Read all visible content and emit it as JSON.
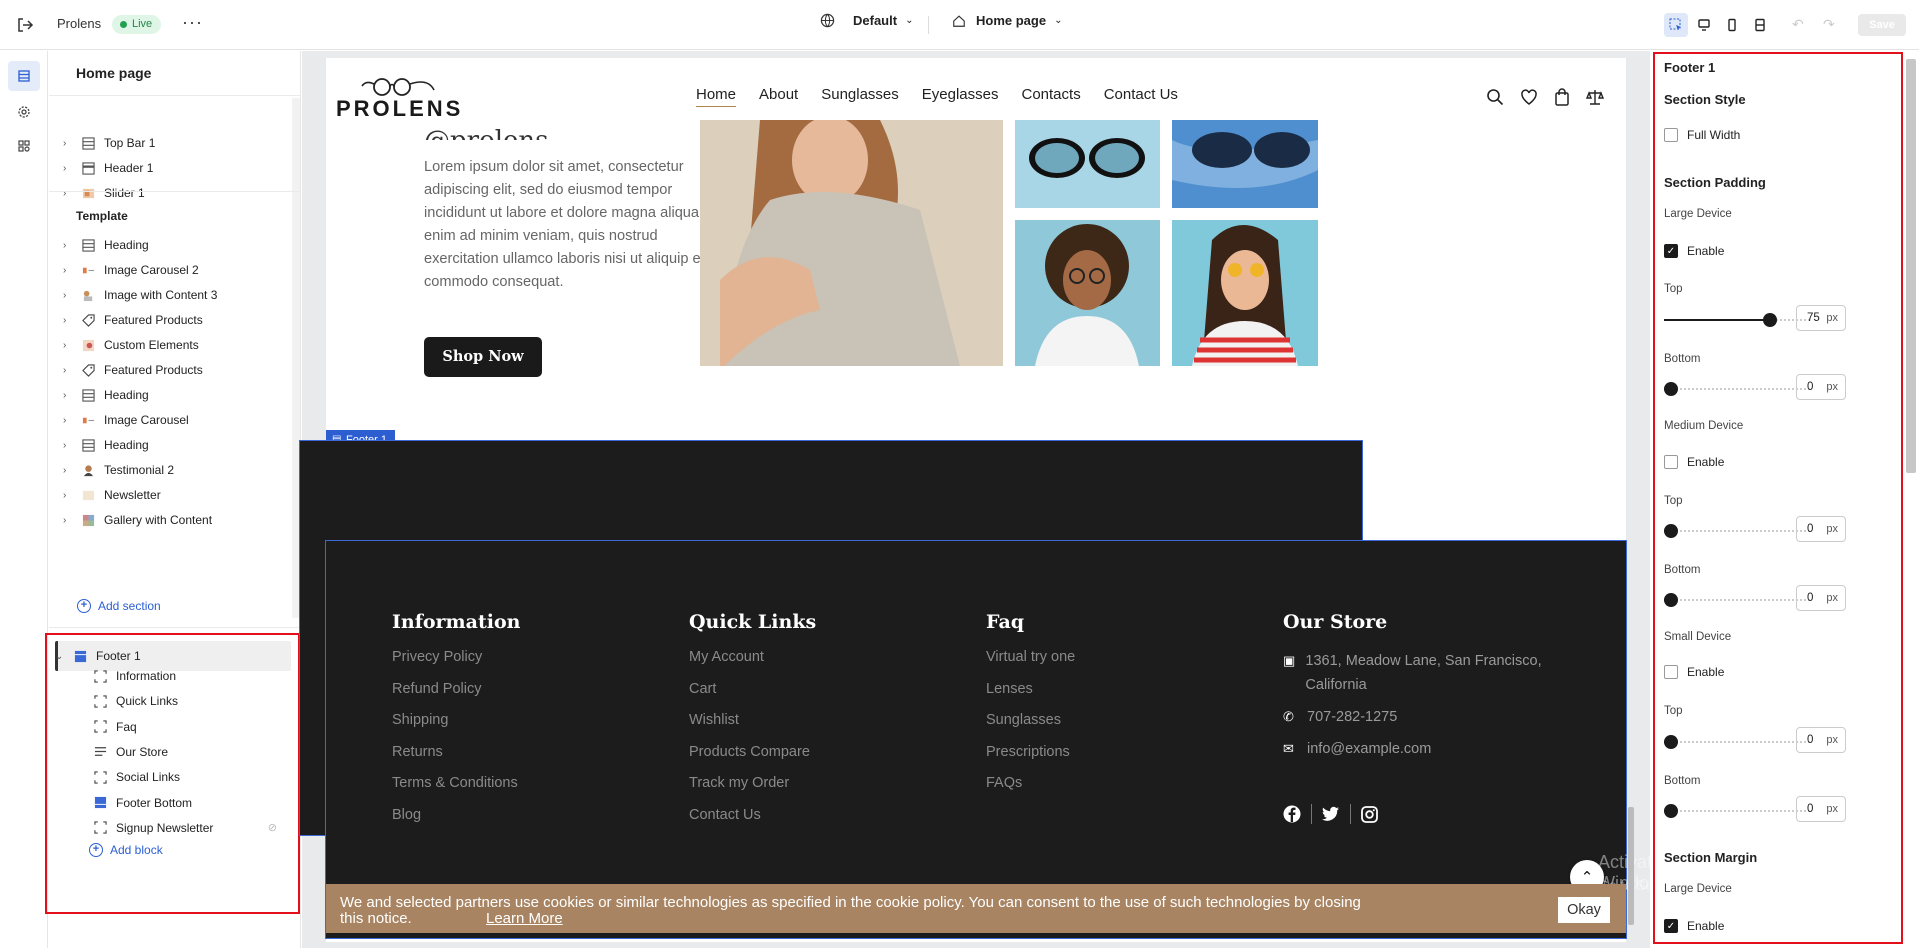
{
  "topbar": {
    "app_name": "Prolens",
    "status": "Live",
    "more": "···",
    "device_view": "Default",
    "page_select": "Home page",
    "save": "Save"
  },
  "tree": {
    "title": "Home page",
    "header_items": [
      {
        "label": "Top Bar 1",
        "icon": "section-icon"
      },
      {
        "label": "Header 1",
        "icon": "header-icon"
      },
      {
        "label": "Slider 1",
        "icon": "slider-icon"
      }
    ],
    "template_label": "Template",
    "template_items": [
      {
        "label": "Heading",
        "icon": "section-icon"
      },
      {
        "label": "Image Carousel 2",
        "icon": "carousel-icon"
      },
      {
        "label": "Image with Content 3",
        "icon": "image-content-icon"
      },
      {
        "label": "Featured Products",
        "icon": "tag-icon"
      },
      {
        "label": "Custom Elements",
        "icon": "custom-elements-icon"
      },
      {
        "label": "Featured Products",
        "icon": "tag-icon"
      },
      {
        "label": "Heading",
        "icon": "section-icon"
      },
      {
        "label": "Image Carousel",
        "icon": "carousel-icon"
      },
      {
        "label": "Heading",
        "icon": "section-icon"
      },
      {
        "label": "Testimonial 2",
        "icon": "testimonial-icon"
      },
      {
        "label": "Newsletter",
        "icon": "newsletter-icon"
      },
      {
        "label": "Gallery with Content",
        "icon": "gallery-icon"
      }
    ],
    "add_section": "Add section",
    "footer": {
      "label": "Footer 1",
      "blocks": [
        {
          "label": "Information",
          "icon": "block-icon"
        },
        {
          "label": "Quick Links",
          "icon": "block-icon"
        },
        {
          "label": "Faq",
          "icon": "block-icon"
        },
        {
          "label": "Our Store",
          "icon": "text-lines-icon"
        },
        {
          "label": "Social Links",
          "icon": "block-icon"
        },
        {
          "label": "Footer Bottom",
          "icon": "footer-bottom-icon"
        },
        {
          "label": "Signup Newsletter",
          "icon": "block-icon"
        }
      ],
      "add_block": "Add block"
    }
  },
  "site": {
    "logo": "PROLENS",
    "nav": [
      "Home",
      "About",
      "Sunglasses",
      "Eyeglasses",
      "Contacts",
      "Contact Us"
    ],
    "hero_cut_title": "@prolens",
    "hero_text": "Lorem ipsum dolor sit amet, consectetur adipiscing elit, sed do eiusmod tempor incididunt ut labore et dolore magna aliqua. Ut enim ad minim veniam, quis nostrud exercitation ullamco laboris nisi ut aliquip ex ea commodo consequat.",
    "shop_now": "Shop Now",
    "footer_tag": "Footer 1",
    "footer": {
      "information": {
        "title": "Information",
        "links": [
          "Privecy Policy",
          "Refund Policy",
          "Shipping",
          "Returns",
          "Terms & Conditions",
          "Blog"
        ]
      },
      "quick_links": {
        "title": "Quick Links",
        "links": [
          "My Account",
          "Cart",
          "Wishlist",
          "Products Compare",
          "Track my Order",
          "Contact Us"
        ]
      },
      "faq": {
        "title": "Faq",
        "links": [
          "Virtual try one",
          "Lenses",
          "Sunglasses",
          "Prescriptions",
          "FAQs"
        ]
      },
      "store": {
        "title": "Our Store",
        "address": "1361, Meadow Lane, San Francisco, California",
        "phone": "707-282-1275",
        "email": "info@example.com"
      }
    },
    "cookie": {
      "text": "We and selected partners use cookies or similar technologies as specified in the cookie policy. You can consent to the use of such technologies by closing this notice.",
      "link": "Learn More",
      "okay": "Okay"
    },
    "watermark_title": "Activate Windows",
    "watermark_sub": "Go to Settings to activate Windows."
  },
  "panel": {
    "title": "Footer 1",
    "section_style": "Section Style",
    "full_width": "Full Width",
    "section_padding": "Section Padding",
    "large_device": "Large Device",
    "enable": "Enable",
    "top": "Top",
    "bottom": "Bottom",
    "px": "px",
    "medium_device": "Medium Device",
    "small_device": "Small Device",
    "section_margin": "Section Margin",
    "large_top_value": "75",
    "large_bottom_value": "0",
    "medium_top_value": "0",
    "medium_bottom_value": "0",
    "small_top_value": "0",
    "small_bottom_value": "0",
    "slider_max": 100,
    "large_enabled": true,
    "medium_enabled": false,
    "small_enabled": false,
    "margin_large_enabled": true
  },
  "colors": {
    "accent": "#2b5fd3",
    "highlight": "#e3101b",
    "footer_bg": "#1c1c1c",
    "cookie_bg": "#a88462"
  }
}
